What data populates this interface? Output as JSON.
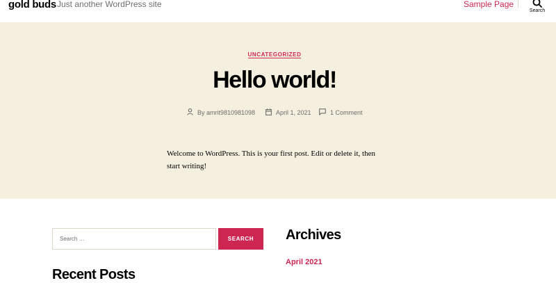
{
  "header": {
    "site_title": "gold buds",
    "site_description": "Just another WordPress site",
    "nav_items": [
      {
        "label": "Sample Page"
      }
    ],
    "search_toggle_label": "Search"
  },
  "entry": {
    "category": "UNCATEGORIZED",
    "title": "Hello world!",
    "author_label": "By amrit9810981098",
    "date": "April 1, 2021",
    "comments": "1 Comment",
    "content": "Welcome to WordPress. This is your first post. Edit or delete it, then start writing!"
  },
  "widgets": {
    "search": {
      "placeholder": "Search …",
      "button_label": "SEARCH"
    },
    "recent_posts_heading": "Recent Posts",
    "archives_heading": "Archives",
    "archives": [
      {
        "label": "April 2021"
      }
    ]
  },
  "colors": {
    "accent": "#cd2653",
    "hero_background": "#f5efe0",
    "secondary_text": "#6d6d6d",
    "border": "#dcd7ca"
  },
  "icons": [
    "search-icon",
    "user-icon",
    "calendar-icon",
    "comment-icon"
  ]
}
